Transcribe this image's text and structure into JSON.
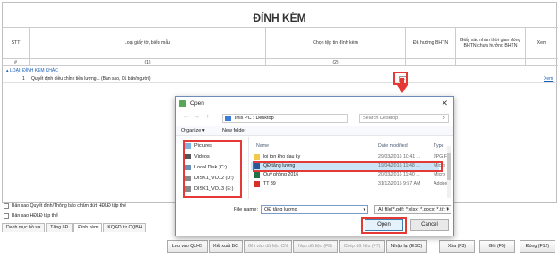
{
  "form": {
    "title": "ĐÍNH KÈM",
    "columns": [
      "STT",
      "Loại giấy tờ, biểu mẫu",
      "Chọn tệp tin đính kèm",
      "Đã hướng BHTN",
      "Giấy xác nhận thời gian đóng BHTN chưa hưởng BHTN",
      "Xem"
    ],
    "subheader": [
      "#",
      "(1)",
      "(2)"
    ],
    "group_label": "LOẠI: ĐÍNH KÈM KHÁC",
    "row": {
      "stt": "1",
      "name": "Quyết định điều chỉnh tiền lương... (Bản sao, 01 bản/người)",
      "browse": "...",
      "view": "Xem"
    }
  },
  "checkboxes": [
    "Bản sao Quyết định/Thông báo chấm dứt HĐLĐ tập thể",
    "Bản sao HĐLĐ tập thể"
  ],
  "tabs": [
    "Danh mục hồ sơ",
    "Tăng LĐ",
    "Đính kèm",
    "KQGD từ CQBH"
  ],
  "buttons": [
    {
      "label": "Lưu vào QLHS",
      "disabled": false
    },
    {
      "label": "Kết xuất BC",
      "disabled": false
    },
    {
      "label": "Ghi vào dữ liệu CN",
      "disabled": true
    },
    {
      "label": "Nạp dữ liệu (F8)",
      "disabled": true
    },
    {
      "label": "Chép dữ liệu (F7)",
      "disabled": true
    },
    {
      "label": "Nhập lại (ESC)",
      "disabled": false
    },
    {
      "label": "Xóa (F3)",
      "disabled": false
    },
    {
      "label": "Ghi (F5)",
      "disabled": false
    },
    {
      "label": "Đóng (F12)",
      "disabled": false
    }
  ],
  "dialog": {
    "title": "Open",
    "close": "✕",
    "path": [
      "This PC",
      "Desktop"
    ],
    "search_placeholder": "Search Desktop",
    "organize": "Organize ▾",
    "new_folder": "New folder",
    "nav_items": [
      "Pictures",
      "Videos",
      "Local Disk (C:)",
      "DISK1_VOL2 (D:)",
      "DISK1_VOL3 (E:)"
    ],
    "file_headers": [
      "Name",
      "Date modified",
      "Type"
    ],
    "files": [
      {
        "name": "loi ton kho dau ky",
        "date": "29/03/2016 10:41 ...",
        "type": "JPG Fil"
      },
      {
        "name": "QĐ tăng lương",
        "date": "19/04/2016 11:48 ...",
        "type": "Micro",
        "selected": true
      },
      {
        "name": "Quỹ phòng 2016",
        "date": "20/03/2016 11:40 ...",
        "type": "Micro"
      },
      {
        "name": "TT 39",
        "date": "31/12/2015 9:57 AM",
        "type": "Adobe"
      }
    ],
    "file_name_label": "File name:",
    "file_name_value": "QĐ tăng lương",
    "filter": "All file(*.pdf; *.xlsx; *.docx; *.tif; *",
    "open": "Open",
    "cancel": "Cancel"
  }
}
